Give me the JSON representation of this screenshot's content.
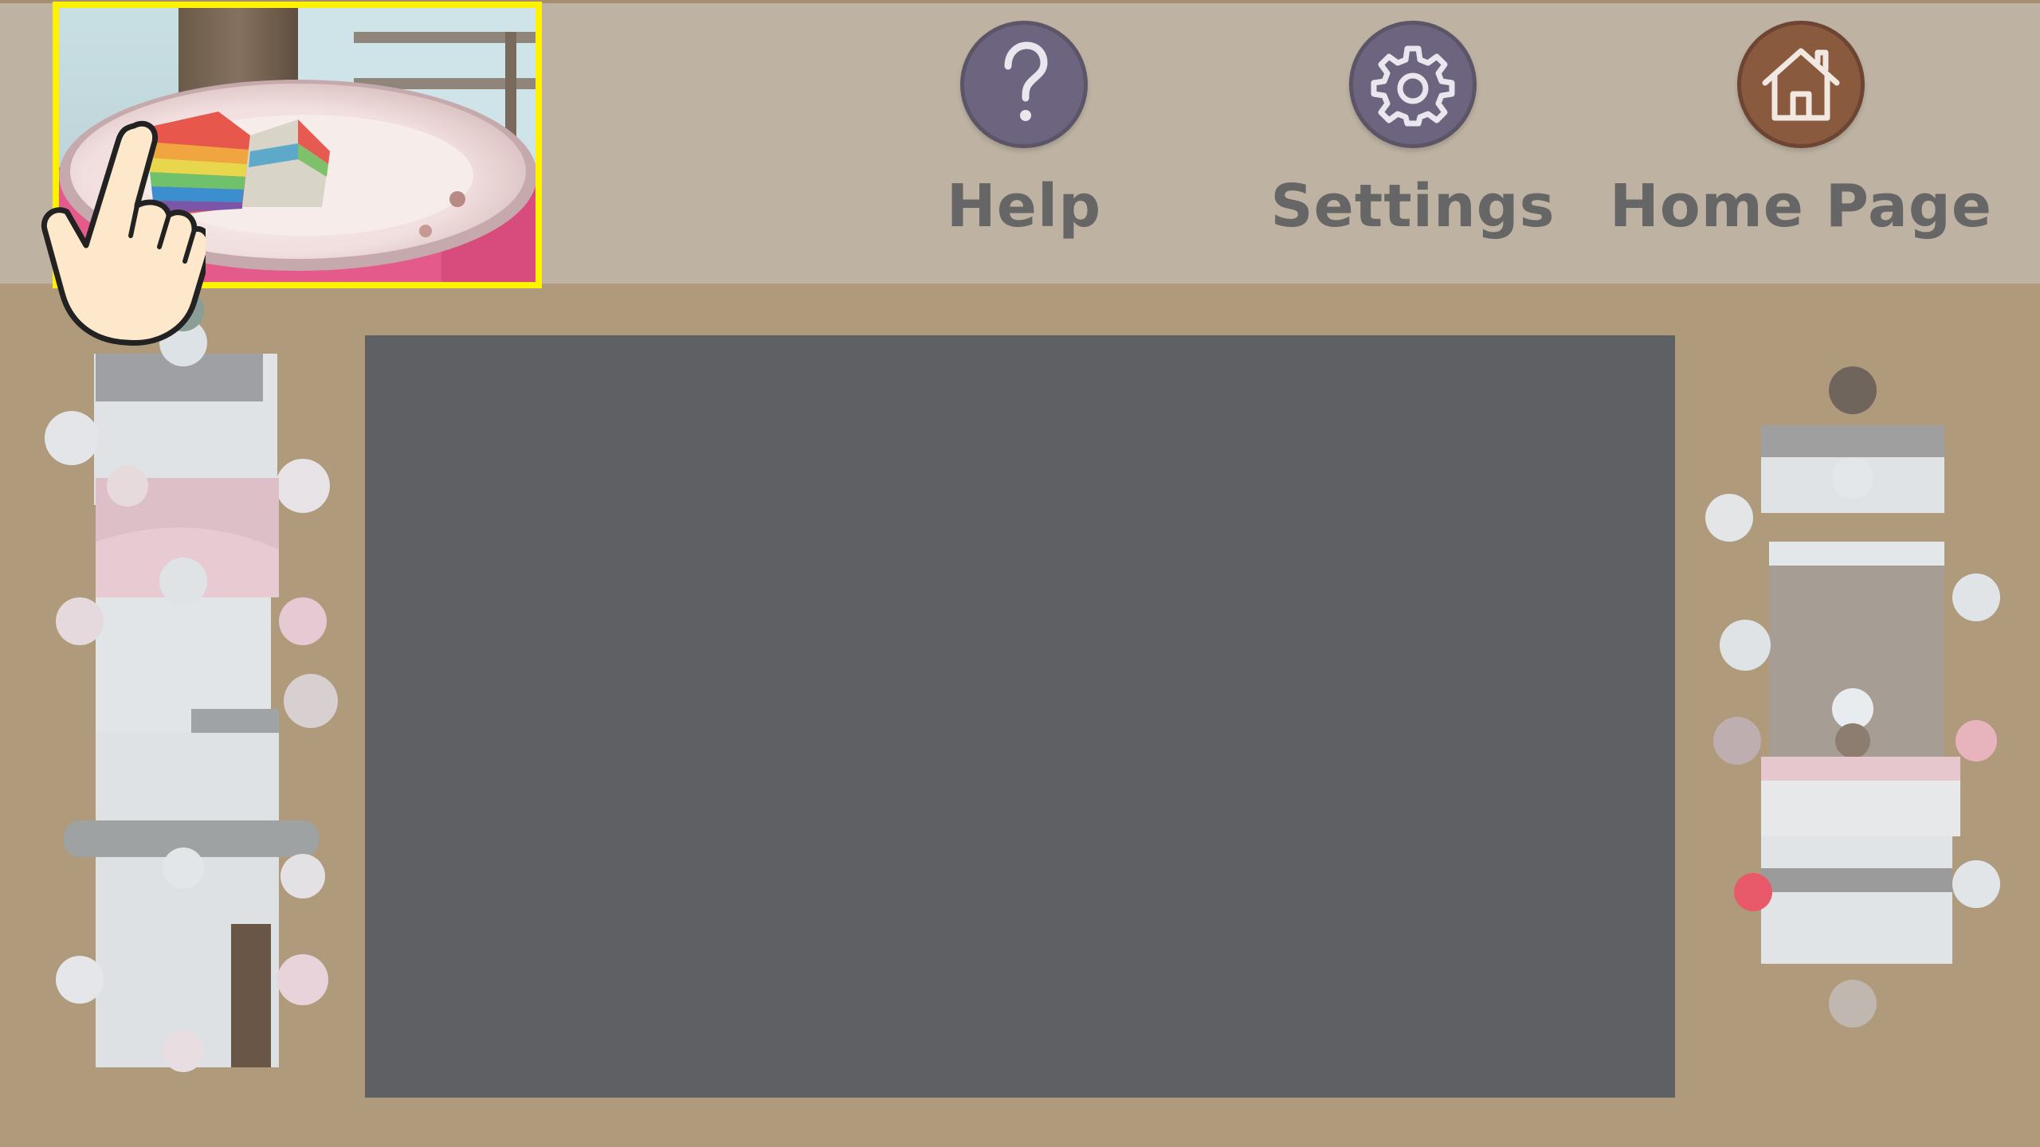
{
  "toolbar": {
    "help": {
      "label": "Help",
      "icon": "question-mark-icon",
      "color": "#6d6580"
    },
    "settings": {
      "label": "Settings",
      "icon": "gear-icon",
      "color": "#6d6580"
    },
    "home": {
      "label": "Home Page",
      "icon": "house-icon",
      "color": "#8a5a3f"
    }
  },
  "reference_image": {
    "subject": "rainbow layer cake slice on a pink-rimmed plate",
    "highlight_color": "#fff200"
  },
  "board": {
    "color": "#5f6063"
  },
  "piece_trays": {
    "left_piece_count": 8,
    "right_piece_count": 5
  },
  "tutorial_hint": {
    "icon": "pointing-hand-icon"
  }
}
